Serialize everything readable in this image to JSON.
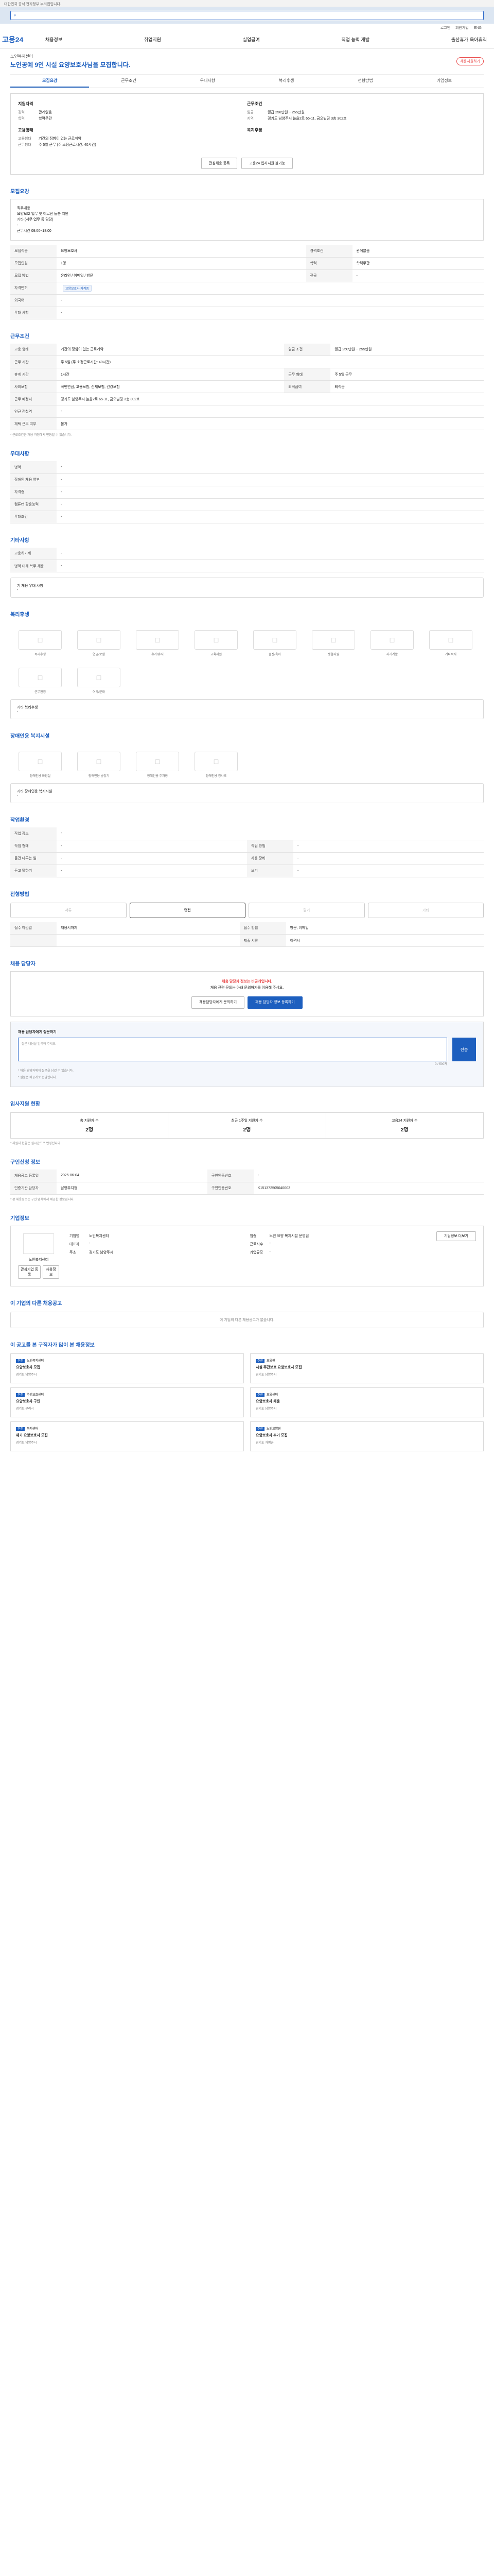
{
  "topbar": "대한민국 공식 전자정부 누리집입니다.",
  "search": {
    "placeholder": ""
  },
  "util": [
    "로그인",
    "회원가입",
    "ENG"
  ],
  "logo": "고용24",
  "gnb": [
    "채용정보",
    "취업지원",
    "실업급여",
    "직업 능력 개발",
    "출산휴가·육아휴직"
  ],
  "hero": {
    "company": "노인복지센터",
    "title": "노인공예 9인 시설 요양보호사님을 모집합니다.",
    "share": "채용지원하기"
  },
  "tabs": [
    "모집요강",
    "근무조건",
    "우대사항",
    "복리후생",
    "전형방법",
    "기업정보"
  ],
  "summary": {
    "left_h1": "지원자격",
    "left_rows1": [
      [
        "경력",
        "관계없음"
      ],
      [
        "학력",
        "학력무관"
      ]
    ],
    "left_h2": "고용형태",
    "left_rows2": [
      [
        "고용형태",
        "기간의 정함이 없는 근로계약"
      ],
      [
        "근무형태",
        "주 5일 근무 (주 소정근로시간: 40시간)"
      ]
    ],
    "right_h1": "근무조건",
    "right_rows1": [
      [
        "임금",
        "월급 250만원 ~ 255만원"
      ],
      [
        "지역",
        "경기도 남양주시 늘을2로 65-11, 금오빌딩 3층 302호"
      ]
    ],
    "right_h2": "복지후생",
    "btn1": "관심채용 등록",
    "btn2": "고용24 입사지원 불가능"
  },
  "s_recruit": {
    "title": "모집요강",
    "text": "직무내용\n요양보호 업무 및 어르신 돌봄 지원\n기타 (서무 업무 등 담당)\n-\n근무시간 09:00~18:00",
    "rows": [
      [
        "모집직종",
        "요양보호사",
        "경력조건",
        "관계없음"
      ],
      [
        "모집인원",
        "1명",
        "학력",
        "학력무관"
      ],
      [
        "모집 방법",
        "온라인 / 이메일 / 방문",
        "전공",
        "-"
      ],
      [
        "자격면허",
        "요양보호사",
        "",
        ""
      ],
      [
        "외국어",
        "-",
        "",
        ""
      ],
      [
        "우대 사항",
        "-",
        "",
        ""
      ]
    ],
    "tag": "요양보호사 자격증"
  },
  "s_work": {
    "title": "근무조건",
    "rows": [
      [
        "고용 형태",
        "기간의 정함이 없는 근로계약",
        "임금 조건",
        "월급 250만원 ~ 255만원"
      ],
      [
        "근무 시간",
        "주 5일 (주 소정근로시간: 40시간)",
        "",
        ""
      ],
      [
        "휴게 시간",
        "1시간",
        "근무 형태",
        "주 5일 근무"
      ],
      [
        "사회보험",
        "국민연금, 고용보험, 산재보험, 건강보험",
        "퇴직급여",
        "퇴직금"
      ],
      [
        "근무 예정지",
        "경기도 남양주시 늘을2로 65-11, 금오빌딩 3층 302호",
        "",
        ""
      ],
      [
        "인근 전철역",
        "-",
        "",
        ""
      ],
      [
        "재택 근무 여부",
        "불가",
        "",
        ""
      ]
    ],
    "note": "* 근로조건은 채용 과정에서 변동될 수 있습니다."
  },
  "s_pref": {
    "title": "우대사항",
    "rows": [
      [
        "병역",
        "-"
      ],
      [
        "장애인 채용 여부",
        "-"
      ],
      [
        "자격증",
        "-"
      ],
      [
        "컴퓨터 활용능력",
        "-"
      ],
      [
        "우대조건",
        "-"
      ]
    ]
  },
  "s_etc": {
    "title": "기타사항",
    "rows": [
      [
        "고용허가제",
        "-"
      ],
      [
        "병역 대체 복무 채용",
        "-"
      ]
    ],
    "sub": "기 채용 우대 사항",
    "sub_val": "-"
  },
  "s_welfare": {
    "title": "복리후생",
    "icons": [
      "복리후생",
      "연금/보험",
      "휴가/휴직",
      "교육지원",
      "출산/육아",
      "생활지원",
      "자기계발",
      "기타복지",
      "근무환경",
      "여가/문화"
    ],
    "sub": "기타 복리후생",
    "sub_val": "-"
  },
  "s_disab": {
    "title": "장애인용 복지시설",
    "icons": [
      "장애인용 화장실",
      "장애인용 승강기",
      "장애인용 주차장",
      "장애인용 경사로"
    ],
    "sub": "기타 장애인용 복지시설",
    "sub_val": "-"
  },
  "s_env": {
    "title": "작업환경",
    "rows": [
      [
        "작업 장소",
        "-",
        "",
        ""
      ],
      [
        "작업 형태",
        "-",
        "작업 방법",
        "-"
      ],
      [
        "물건 다루는 일",
        "-",
        "사용 장비",
        "-"
      ],
      [
        "듣고 말하기",
        "-",
        "보기",
        "-"
      ]
    ]
  },
  "s_method": {
    "title": "전형방법",
    "methods": [
      "서류",
      "면접",
      "필기",
      "기타"
    ],
    "box_rows": [
      [
        "접수 마감일",
        "채용시까지",
        "접수 방법",
        "방문, 이메일"
      ],
      [
        "",
        "",
        "제출 서류",
        "이력서"
      ]
    ]
  },
  "s_contact": {
    "title": "채용 담당자",
    "line1": "채용 담당자 정보는 비공개입니다.",
    "line2": "채용 관련 문의는 아래 문의하기를 이용해 주세요.",
    "btn1": "채용담당자에게 문의하기",
    "btn2": "채용 담당자 정보 등록하기"
  },
  "s_inquiry": {
    "title": "채용 담당자에게 질문하기",
    "placeholder": "질문 내용을 입력해 주세요.",
    "send": "전송",
    "count": "0 / 500자",
    "notes": [
      "* 채용 담당자에게 질문을 남길 수 있습니다.",
      "* 질문은 비공개로 전달됩니다."
    ]
  },
  "s_stats": {
    "title": "입사지원 현황",
    "items": [
      [
        "총 지원자 수",
        "2명"
      ],
      [
        "최근 1주일 지원자 수",
        "2명"
      ],
      [
        "고용24 지원자 수",
        "2명"
      ]
    ],
    "note": "* 지원자 현황은 실시간으로 반영됩니다."
  },
  "s_info": {
    "title": "구인신청 정보",
    "rows": [
      [
        "채용공고 등록일",
        "2025-06-04",
        "구인인증번호",
        "-"
      ],
      [
        "인증기관 담당자",
        "남양주지청",
        "구인인증번호",
        "K151372505040003"
      ]
    ],
    "note": "* 본 채용정보는 구인 업체에서 제공한 정보입니다."
  },
  "s_company": {
    "title": "기업정보",
    "name": "노인복지센터",
    "btn1": "관심기업 등록",
    "btn2": "채용정보",
    "info": [
      [
        "기업명",
        "노인복지센터"
      ],
      [
        "업종",
        "노인 요양 복지시설 운영업"
      ],
      [
        "대표자",
        "-"
      ],
      [
        "근로자수",
        "-"
      ],
      [
        "주소",
        "경기도 남양주시"
      ],
      [
        "기업규모",
        "-"
      ]
    ],
    "more": "기업정보 더보기"
  },
  "s_other": {
    "title": "이 기업의 다른 채용공고",
    "empty": "이 기업의 다른 채용공고가 없습니다."
  },
  "s_rec": {
    "title": "이 공고를 본 구직자가 많이 본 채용정보",
    "cards": [
      {
        "badge": "추천",
        "co": "노인복지센터",
        "title": "요양보호사 모집",
        "foot": "경기도 남양주시"
      },
      {
        "badge": "추천",
        "co": "요양원",
        "title": "시설 주간보호 요양보호사 모집",
        "foot": "경기도 남양주시"
      },
      {
        "badge": "추천",
        "co": "주간보호센터",
        "title": "요양보호사 구인",
        "foot": "경기도 구리시"
      },
      {
        "badge": "추천",
        "co": "요양센터",
        "title": "요양보호사 채용",
        "foot": "경기도 남양주시"
      },
      {
        "badge": "추천",
        "co": "복지센터",
        "title": "재가 요양보호사 모집",
        "foot": "경기도 남양주시"
      },
      {
        "badge": "추천",
        "co": "노인요양원",
        "title": "요양보호사 추가 모집",
        "foot": "경기도 가평군"
      }
    ]
  }
}
